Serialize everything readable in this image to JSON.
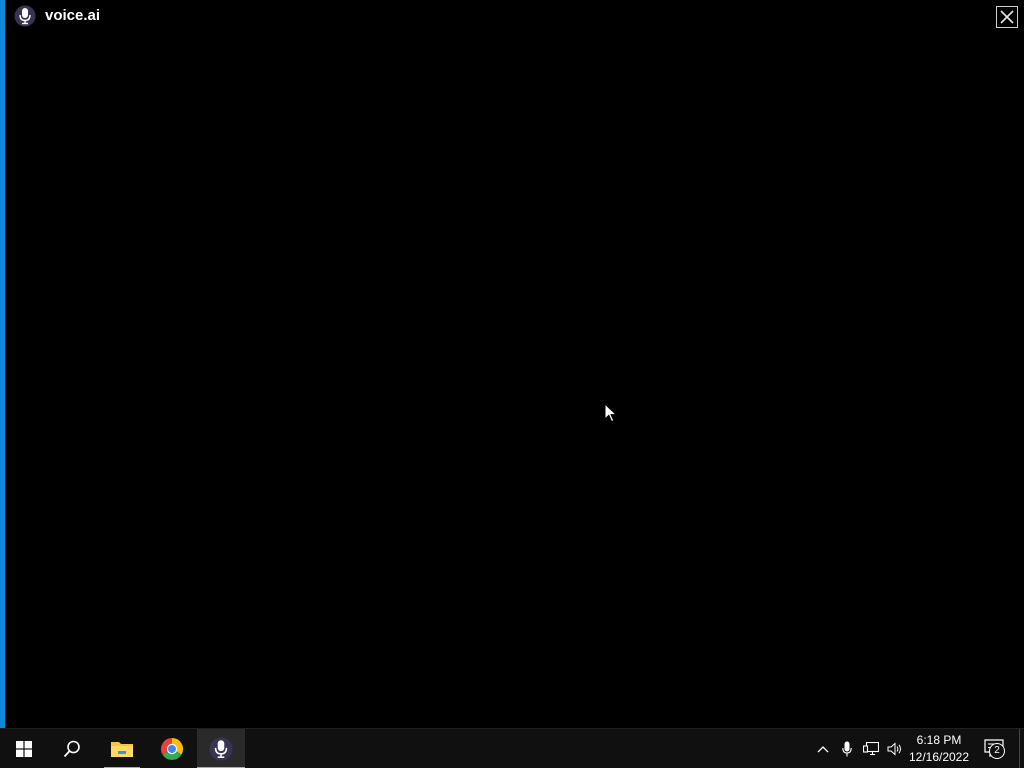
{
  "window": {
    "title": "voice.ai",
    "logo_icon": "microphone-logo-icon",
    "close_icon": "close-icon"
  },
  "taskbar": {
    "start_icon": "windows-start-icon",
    "search_icon": "search-icon",
    "pinned": [
      {
        "name": "File Explorer",
        "icon": "folder-icon",
        "running": true
      },
      {
        "name": "Google Chrome",
        "icon": "chrome-icon",
        "running": false
      },
      {
        "name": "voice.ai",
        "icon": "microphone-icon",
        "running": true,
        "active": true
      }
    ],
    "tray": {
      "icons": [
        "chevron-up-icon",
        "microphone-tray-icon",
        "network-icon",
        "volume-icon"
      ],
      "time": "6:18 PM",
      "date": "12/16/2022",
      "notification_count": "2"
    }
  },
  "colors": {
    "accent": "#0a8ad9",
    "taskbar": "#101010",
    "running_indicator": "#76b9ed"
  }
}
